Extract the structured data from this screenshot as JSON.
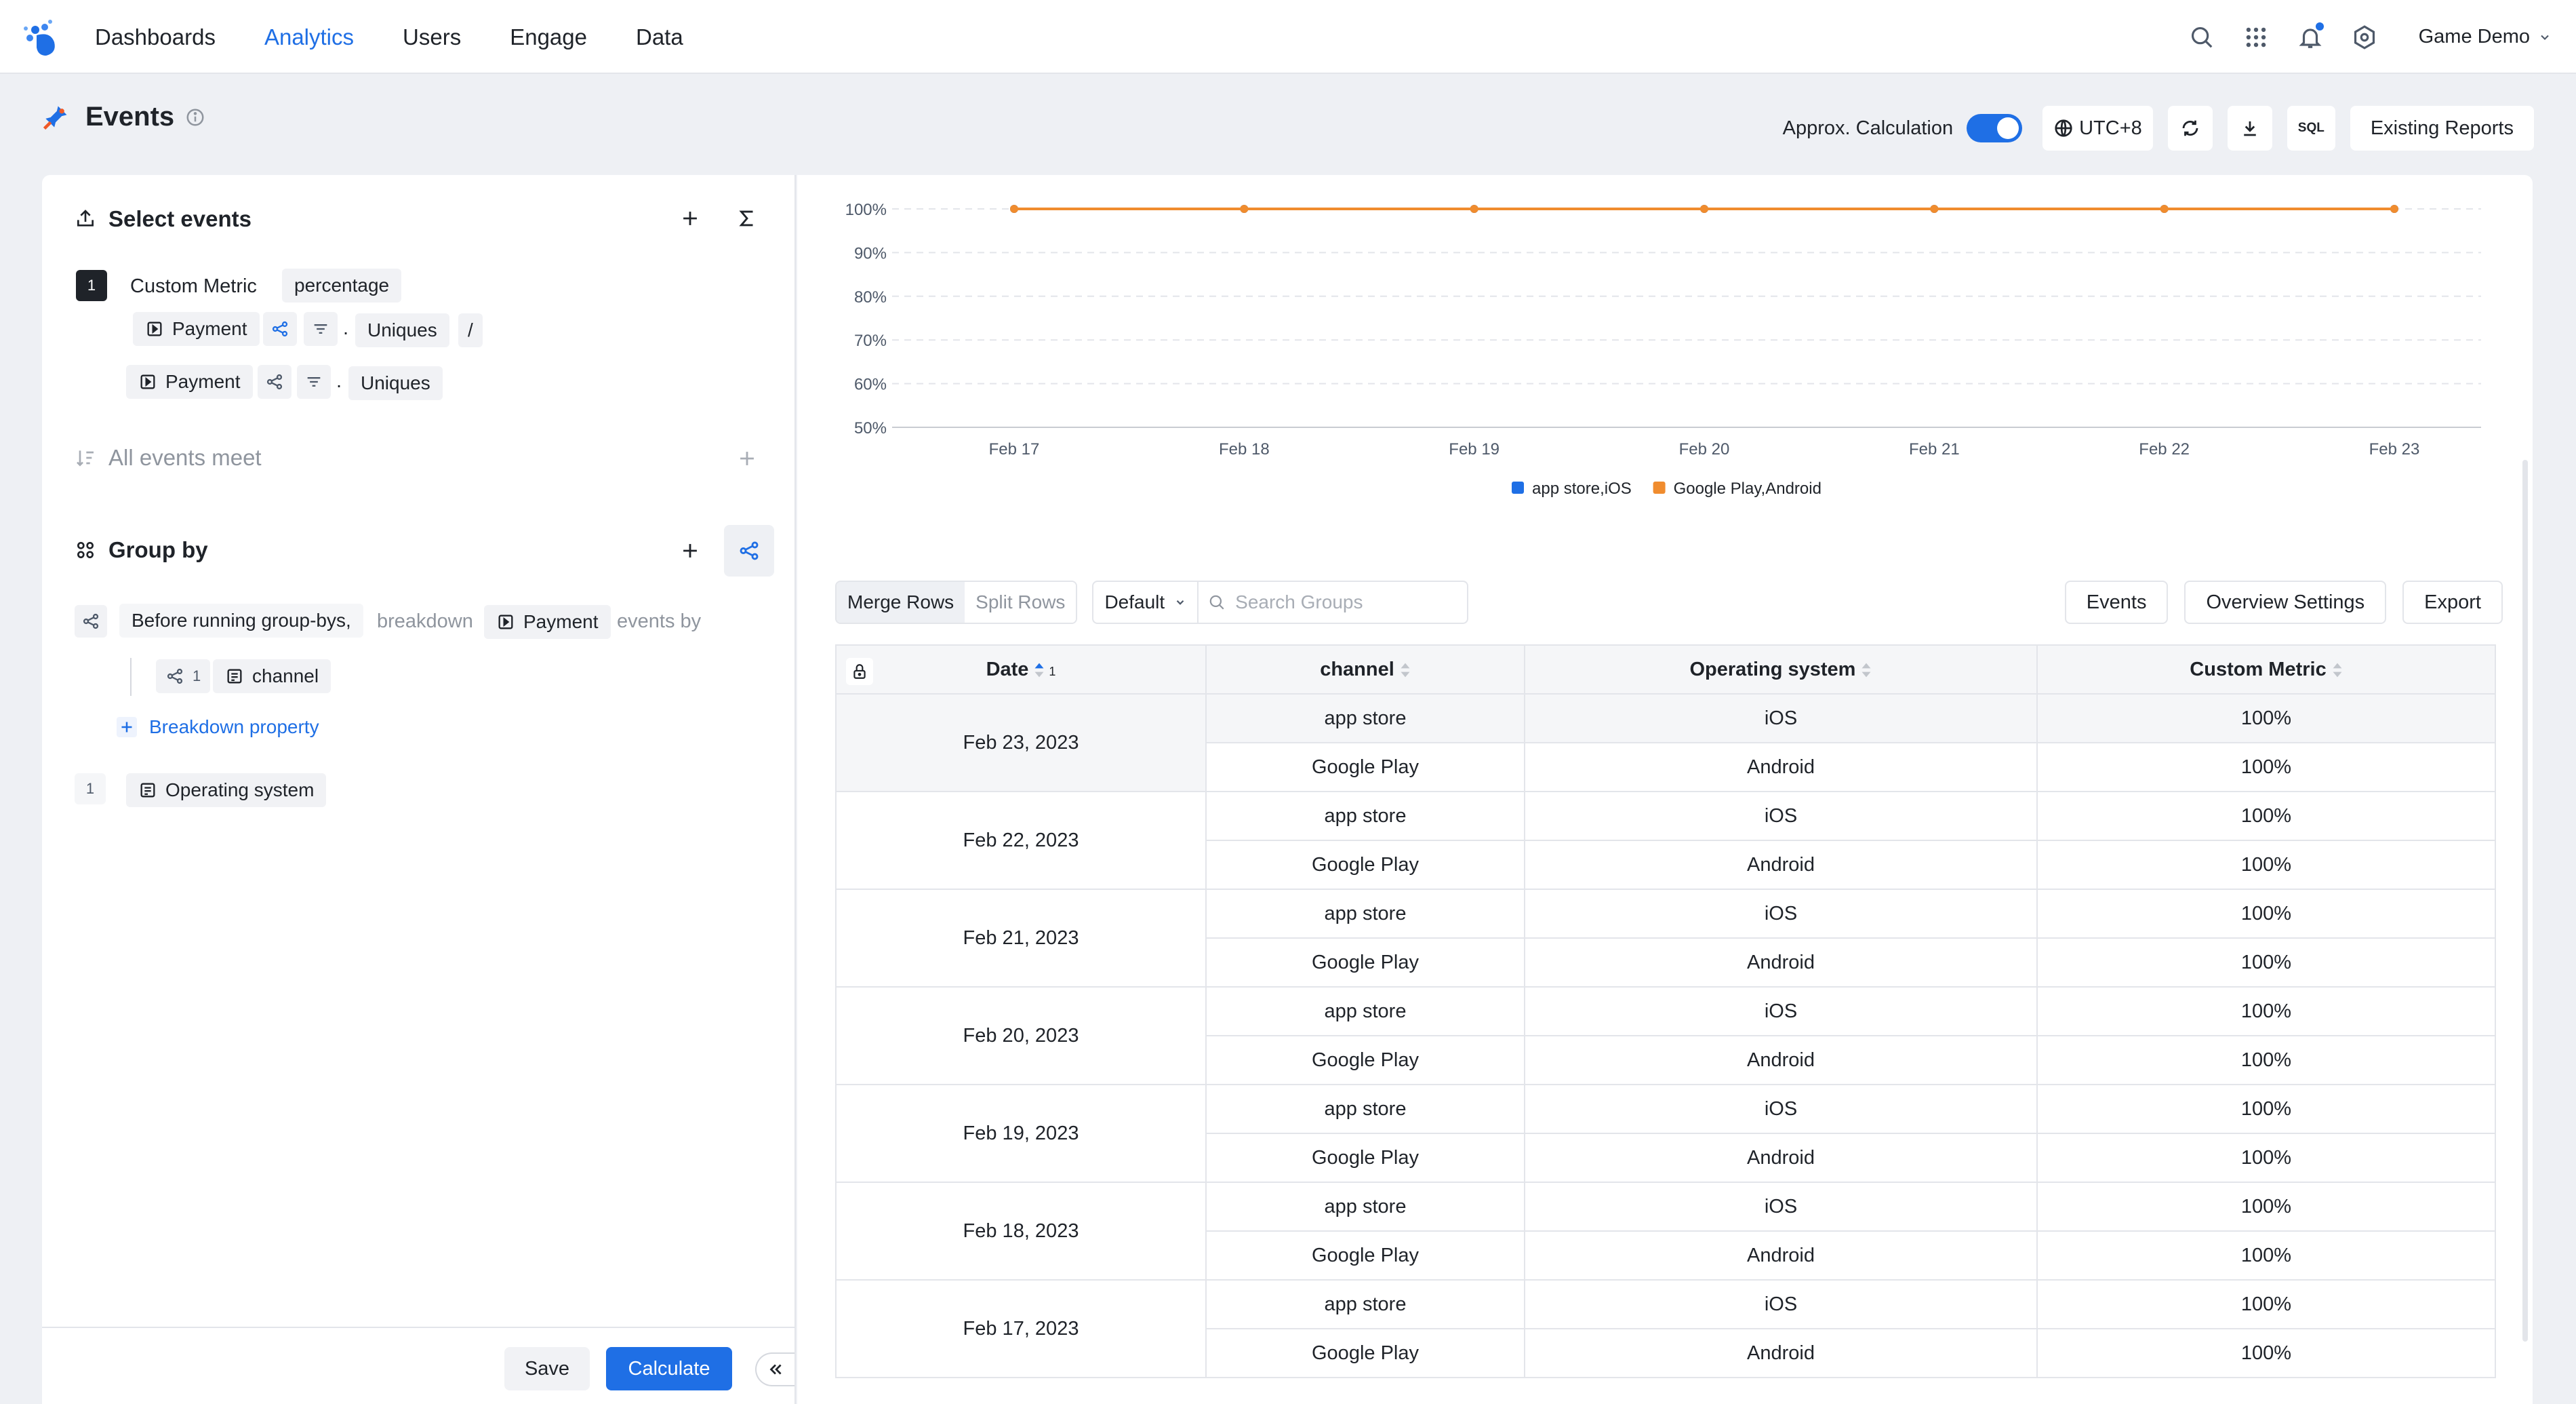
{
  "nav": {
    "items": [
      "Dashboards",
      "Analytics",
      "Users",
      "Engage",
      "Data"
    ],
    "active_index": 1,
    "project_name": "Game Demo"
  },
  "page": {
    "title": "Events",
    "approx_label": "Approx. Calculation",
    "approx_enabled": true,
    "timezone": "UTC+8",
    "sql_label": "SQL",
    "existing_reports": "Existing Reports"
  },
  "select_events": {
    "title": "Select events",
    "metric_number": "1",
    "metric_name": "Custom Metric",
    "metric_format": "percentage",
    "numerator": {
      "event": "Payment",
      "dot": ".",
      "agg": "Uniques",
      "op": "/"
    },
    "denominator": {
      "event": "Payment",
      "dot": ".",
      "agg": "Uniques"
    },
    "all_events_meet": "All events meet"
  },
  "group_by": {
    "title": "Group by",
    "before_text": "Before running group-bys,",
    "breakdown_word": "breakdown",
    "breakdown_event": "Payment",
    "events_by": "events by",
    "sub_badge": "1",
    "sub_property": "channel",
    "add_breakdown": "Breakdown property",
    "group_number": "1",
    "group_property": "Operating system"
  },
  "footer": {
    "save": "Save",
    "calculate": "Calculate"
  },
  "chart_data": {
    "type": "line",
    "x": [
      "Feb 17",
      "Feb 18",
      "Feb 19",
      "Feb 20",
      "Feb 21",
      "Feb 22",
      "Feb 23"
    ],
    "y_ticks": [
      "100%",
      "90%",
      "80%",
      "70%",
      "60%",
      "50%"
    ],
    "ylim": [
      50,
      100
    ],
    "series": [
      {
        "name": "app store,iOS",
        "color": "#1f6fe5",
        "values": [
          100,
          100,
          100,
          100,
          100,
          100,
          100
        ]
      },
      {
        "name": "Google Play,Android",
        "color": "#f08c2e",
        "values": [
          100,
          100,
          100,
          100,
          100,
          100,
          100
        ]
      }
    ],
    "grid": true,
    "legend": "bottom"
  },
  "table_controls": {
    "merge_rows": "Merge Rows",
    "split_rows": "Split Rows",
    "sort_select": "Default",
    "search_placeholder": "Search Groups",
    "events_btn": "Events",
    "overview_btn": "Overview Settings",
    "export_btn": "Export"
  },
  "table": {
    "headers": {
      "date": "Date",
      "date_sort_order": "1",
      "channel": "channel",
      "os": "Operating system",
      "metric": "Custom Metric"
    },
    "groups": [
      {
        "date": "Feb 23, 2023",
        "rows": [
          {
            "channel": "app store",
            "os": "iOS",
            "value": "100%"
          },
          {
            "channel": "Google Play",
            "os": "Android",
            "value": "100%"
          }
        ]
      },
      {
        "date": "Feb 22, 2023",
        "rows": [
          {
            "channel": "app store",
            "os": "iOS",
            "value": "100%"
          },
          {
            "channel": "Google Play",
            "os": "Android",
            "value": "100%"
          }
        ]
      },
      {
        "date": "Feb 21, 2023",
        "rows": [
          {
            "channel": "app store",
            "os": "iOS",
            "value": "100%"
          },
          {
            "channel": "Google Play",
            "os": "Android",
            "value": "100%"
          }
        ]
      },
      {
        "date": "Feb 20, 2023",
        "rows": [
          {
            "channel": "app store",
            "os": "iOS",
            "value": "100%"
          },
          {
            "channel": "Google Play",
            "os": "Android",
            "value": "100%"
          }
        ]
      },
      {
        "date": "Feb 19, 2023",
        "rows": [
          {
            "channel": "app store",
            "os": "iOS",
            "value": "100%"
          },
          {
            "channel": "Google Play",
            "os": "Android",
            "value": "100%"
          }
        ]
      },
      {
        "date": "Feb 18, 2023",
        "rows": [
          {
            "channel": "app store",
            "os": "iOS",
            "value": "100%"
          },
          {
            "channel": "Google Play",
            "os": "Android",
            "value": "100%"
          }
        ]
      },
      {
        "date": "Feb 17, 2023",
        "rows": [
          {
            "channel": "app store",
            "os": "iOS",
            "value": "100%"
          },
          {
            "channel": "Google Play",
            "os": "Android",
            "value": "100%"
          }
        ]
      }
    ]
  }
}
